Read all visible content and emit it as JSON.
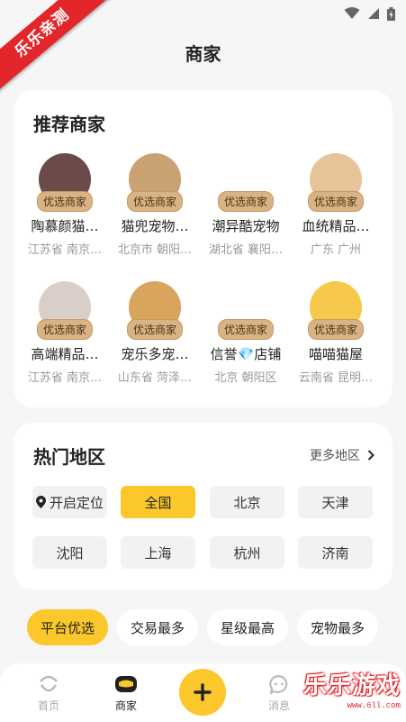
{
  "watermark": {
    "ribbon": "乐乐亲测",
    "brand": "乐乐游戏",
    "url": "www.6ll.com"
  },
  "header": {
    "title": "商家"
  },
  "recommended": {
    "title": "推荐商家",
    "badge": "优选商家",
    "merchants": [
      {
        "name": "陶慕颜猫…",
        "location": "江苏省 南京…",
        "avatar_icon": "person-photo",
        "avatar_color": "#6b4a4a"
      },
      {
        "name": "猫兜宠物…",
        "location": "北京市 朝阳…",
        "avatar_icon": "cat-photo",
        "avatar_color": "#caa173"
      },
      {
        "name": "潮异酷宠物",
        "location": "湖北省 襄阳…",
        "avatar_icon": "fox-logo",
        "avatar_color": "#ffffff"
      },
      {
        "name": "血统精品…",
        "location": "广东 广州",
        "avatar_icon": "dog-photo",
        "avatar_color": "#e7c39a"
      },
      {
        "name": "高端精品…",
        "location": "江苏省 南京…",
        "avatar_icon": "hamster-photo",
        "avatar_color": "#d9cfc8"
      },
      {
        "name": "宠乐多宠…",
        "location": "山东省 菏泽…",
        "avatar_icon": "sunset-photo",
        "avatar_color": "#d9a45e"
      },
      {
        "name": "信誉💎店铺",
        "location": "北京 朝阳区",
        "avatar_icon": "flag-cartoon",
        "avatar_color": "#ffffff"
      },
      {
        "name": "喵喵猫屋",
        "location": "云南省 昆明…",
        "avatar_icon": "puppy-cartoon",
        "avatar_color": "#f7c94b"
      }
    ]
  },
  "regions": {
    "title": "热门地区",
    "more_label": "更多地区",
    "locate_label": "开启定位",
    "chips": [
      "全国",
      "北京",
      "天津",
      "沈阳",
      "上海",
      "杭州",
      "济南"
    ],
    "active_chip": "全国"
  },
  "filters": [
    "平台优选",
    "交易最多",
    "星级最高",
    "宠物最多"
  ],
  "tabs": [
    {
      "label": "首页",
      "icon": "home-icon"
    },
    {
      "label": "商家",
      "icon": "shop-icon"
    },
    {
      "label": "消息",
      "icon": "message-icon"
    }
  ],
  "colors": {
    "accent": "#fcc72b",
    "badge": "#d9b383",
    "ribbon": "#e3262a"
  }
}
